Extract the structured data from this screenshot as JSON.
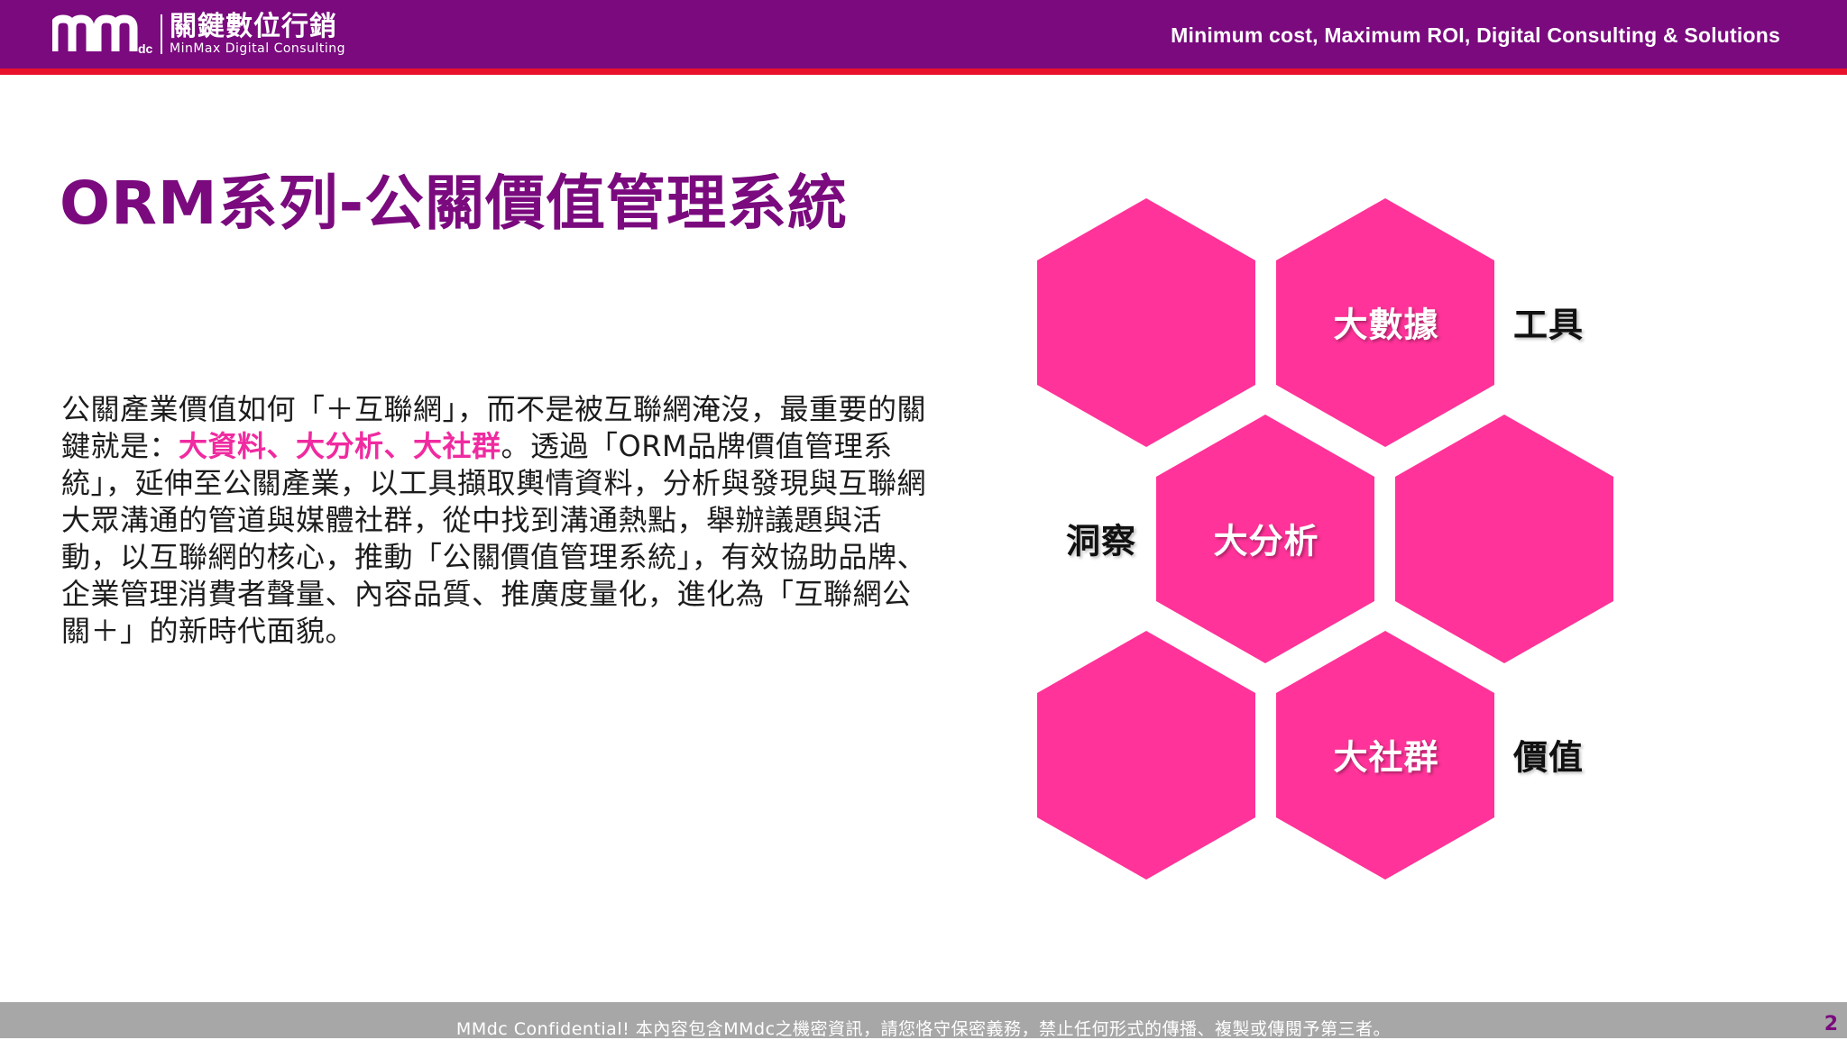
{
  "header": {
    "logo_zh": "關鍵數位行銷",
    "logo_en": "MinMax Digital Consulting",
    "tagline": "Minimum cost, Maximum ROI, Digital Consulting & Solutions",
    "brand_color": "#7a0a7e",
    "accent_line_color": "#e8102a"
  },
  "slide": {
    "title": "ORM系列-公關價值管理系統",
    "paragraph": {
      "part1": "公關產業價值如何「＋互聯網」，而不是被互聯網淹沒，最重要的關鍵就是：",
      "highlight": "大資料、大分析、大社群",
      "part2": "。透過「ORM品牌價值管理系統」，延伸至公關產業，以工具擷取輿情資料，分析與發現與互聯網大眾溝通的管道與媒體社群，從中找到溝通熱點，舉辦議題與活動，以互聯網的核心，推動「公關價值管理系統」，有效協助品牌、企業管理消費者聲量、內容品質、推廣度量化，進化為「互聯網公關＋」的新時代面貌。"
    },
    "highlight_color": "#f02aa0",
    "hexagon_color": "#ff3399",
    "hexagons": {
      "big_data": "大數據",
      "big_analysis": "大分析",
      "big_community": "大社群"
    },
    "side_labels": {
      "tools": "工具",
      "insight": "洞察",
      "value": "價值"
    }
  },
  "footer": {
    "confidential": "MMdc Confidential!  本內容包含MMdc之機密資訊，請您恪守保密義務，禁止任何形式的傳播、複製或傳閱予第三者。",
    "page_number": "2"
  }
}
